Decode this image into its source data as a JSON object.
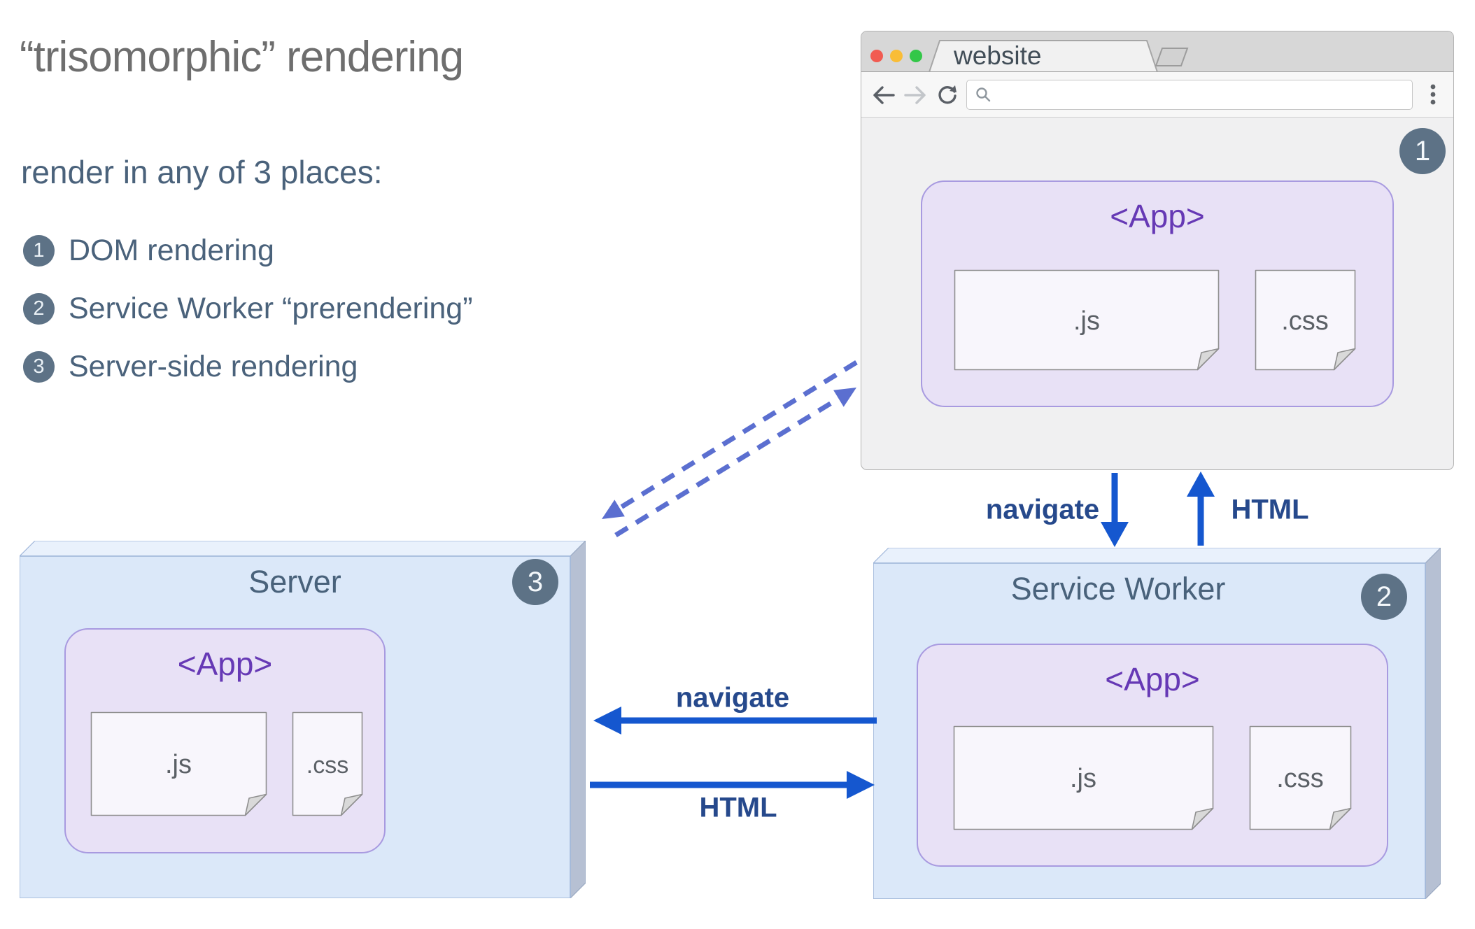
{
  "intro": {
    "title": "“trisomorphic” rendering",
    "subtitle": "render in any of 3 places:",
    "items": [
      {
        "num": "1",
        "label": "DOM rendering"
      },
      {
        "num": "2",
        "label": "Service Worker “prerendering”"
      },
      {
        "num": "3",
        "label": "Server-side rendering"
      }
    ]
  },
  "browser": {
    "tab_title": "website",
    "url_value": "",
    "badge": "1",
    "app": {
      "label": "<App>",
      "js": ".js",
      "css": ".css"
    }
  },
  "server": {
    "title": "Server",
    "badge": "3",
    "app": {
      "label": "<App>",
      "js": ".js",
      "css": ".css"
    }
  },
  "service_worker": {
    "title": "Service Worker",
    "badge": "2",
    "app": {
      "label": "<App>",
      "js": ".js",
      "css": ".css"
    }
  },
  "arrows": {
    "browser_to_sw": "navigate",
    "sw_to_browser": "HTML",
    "sw_to_server": "navigate",
    "server_to_sw": "HTML"
  },
  "colors": {
    "arrow_blue": "#1557cf",
    "dashed_blue": "#5b6fd0",
    "badge_slate": "#5d7286",
    "app_purple": "#6639b5",
    "box_blue_fill": "#dbe8f9",
    "app_lavender_fill": "#e8e1f6"
  }
}
